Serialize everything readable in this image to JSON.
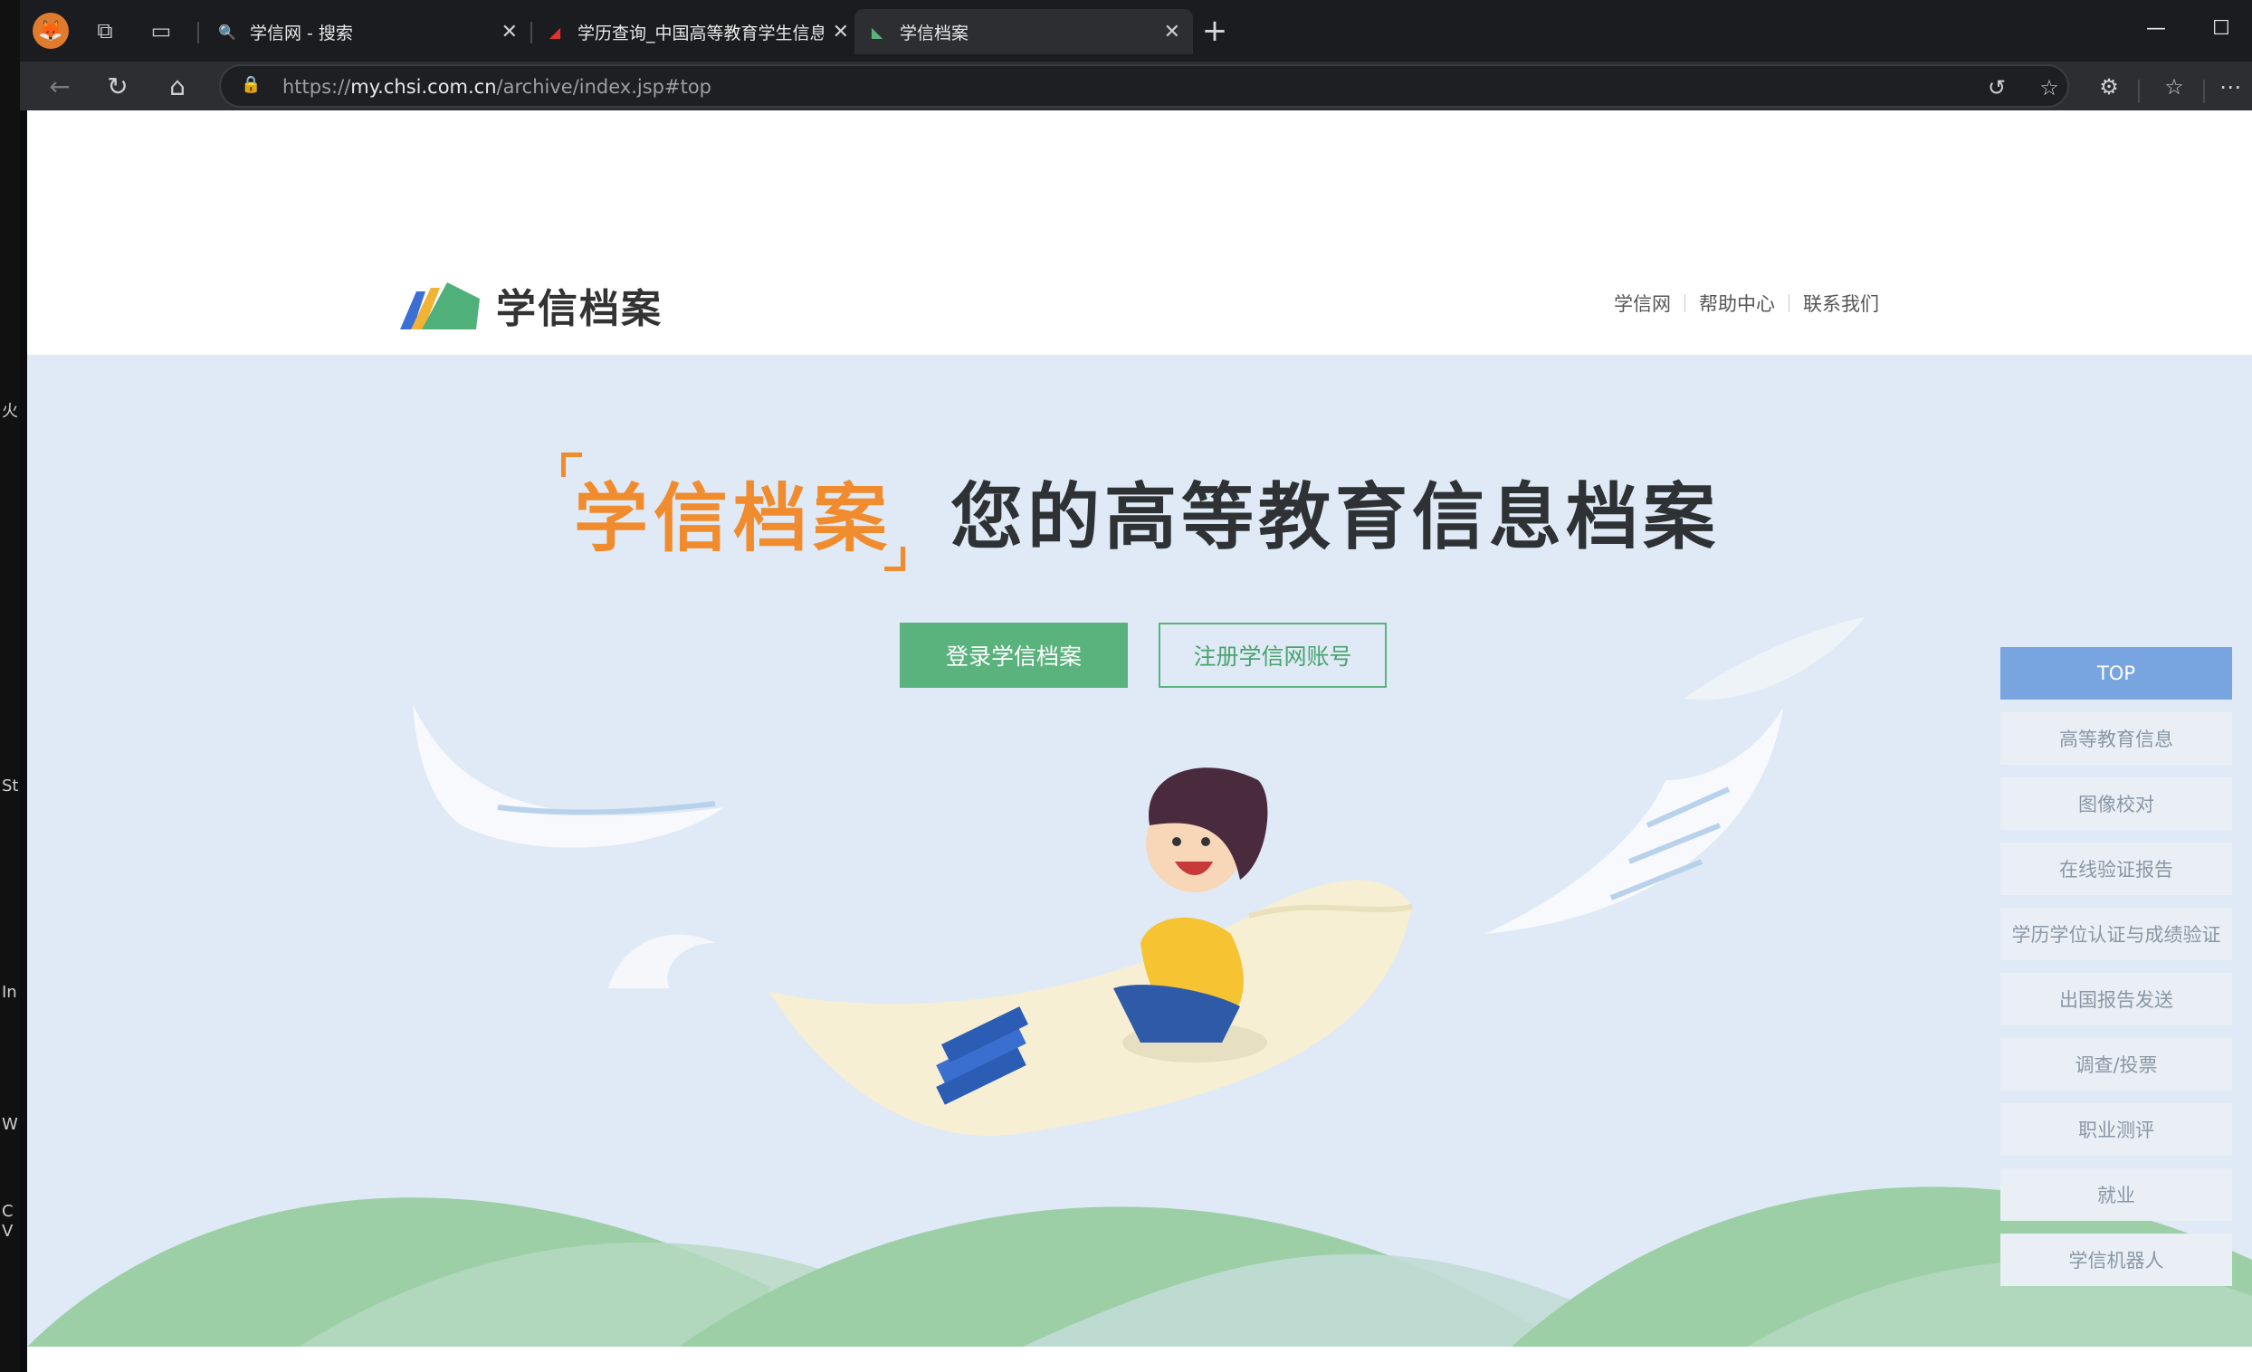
{
  "browser": {
    "profile_icon": "fox-avatar-icon",
    "tabs": [
      {
        "title": "学信网 - 搜索",
        "favicon": "search-icon",
        "active": false
      },
      {
        "title": "学历查询_中国高等教育学生信息",
        "favicon": "chsi-red-icon",
        "active": false
      },
      {
        "title": "学信档案",
        "favicon": "chsi-archive-icon",
        "active": true
      }
    ],
    "address": {
      "prefix": "https://",
      "host": "my.chsi.com.cn",
      "path": "/archive/index.jsp#top"
    }
  },
  "desktop_edge": {
    "labels": [
      "火",
      "St",
      "In",
      "W",
      "C",
      "V"
    ]
  },
  "site": {
    "logo_text": "学信档案",
    "top_links": [
      "学信网",
      "帮助中心",
      "联系我们"
    ],
    "hero": {
      "brand": "学信档案",
      "slogan": "您的高等教育信息档案",
      "login_button": "登录学信档案",
      "register_button": "注册学信网账号"
    },
    "side_nav": [
      "TOP",
      "高等教育信息",
      "图像校对",
      "在线验证报告",
      "学历学位认证与成绩验证",
      "出国报告发送",
      "调查/投票",
      "职业测评",
      "就业",
      "学信机器人"
    ]
  },
  "colors": {
    "accent_green": "#5ab27c",
    "accent_orange": "#f08c2e",
    "hero_bg": "#dfeaf6",
    "side_top": "#78a5e0"
  }
}
